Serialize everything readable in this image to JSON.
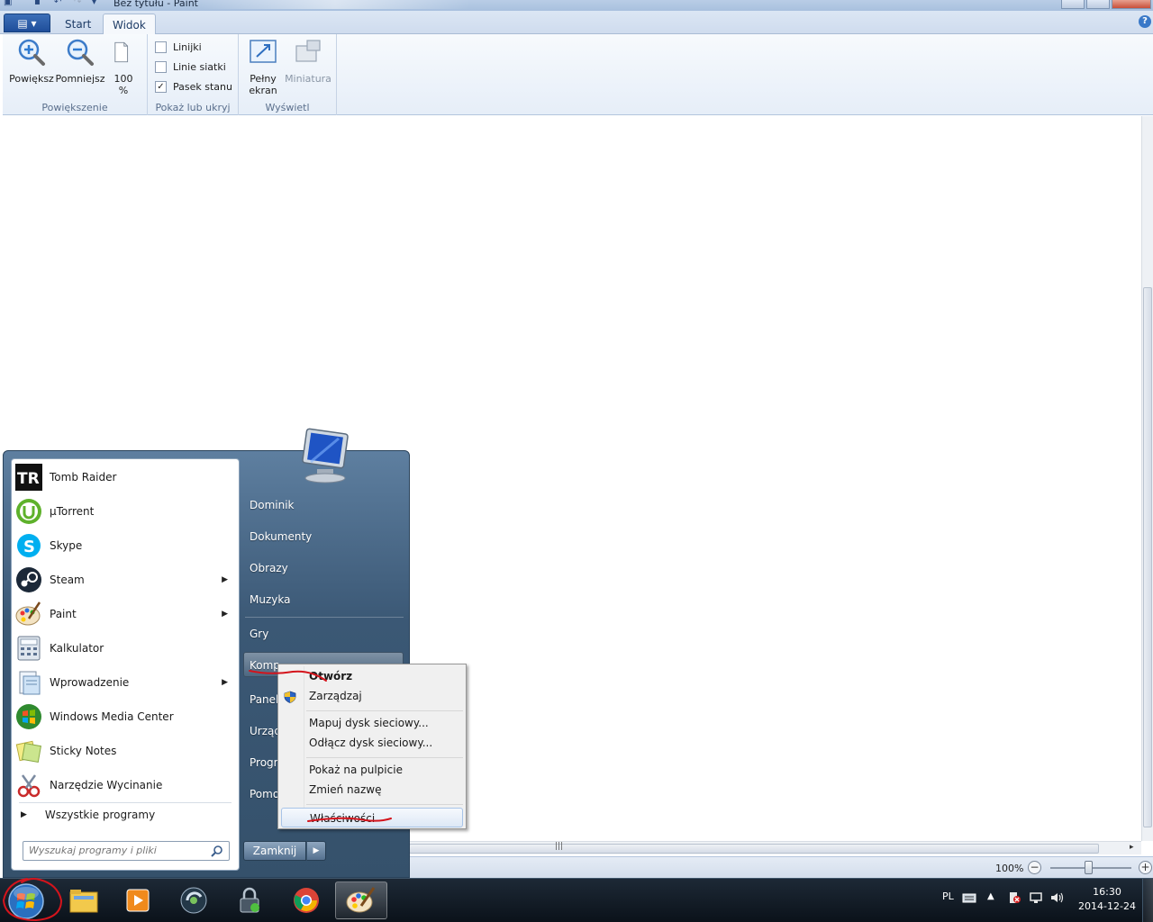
{
  "window": {
    "title": "Bez tytułu - Paint"
  },
  "ribbon": {
    "tabs": [
      "Start",
      "Widok"
    ],
    "active_tab": "Widok",
    "groups": {
      "zoom": {
        "label": "Powiększenie",
        "zoom_in": "Powiększ",
        "zoom_out": "Pomniejsz",
        "hundred_line1": "100",
        "hundred_line2": "%"
      },
      "show_hide": {
        "label": "Pokaż lub ukryj",
        "rulers": "Linijki",
        "rulers_checked": false,
        "gridlines": "Linie siatki",
        "gridlines_checked": false,
        "statusbar": "Pasek stanu",
        "statusbar_checked": true
      },
      "display": {
        "label": "Wyświetl",
        "fullscreen_line1": "Pełny",
        "fullscreen_line2": "ekran",
        "thumbnail": "Miniatura"
      }
    }
  },
  "status": {
    "zoom": "100%"
  },
  "start_menu": {
    "programs": [
      {
        "label": "Tomb Raider",
        "icon": "tomb-raider-icon",
        "submenu": false
      },
      {
        "label": "µTorrent",
        "icon": "utorrent-icon",
        "submenu": false
      },
      {
        "label": "Skype",
        "icon": "skype-icon",
        "submenu": false
      },
      {
        "label": "Steam",
        "icon": "steam-icon",
        "submenu": true
      },
      {
        "label": "Paint",
        "icon": "paint-icon",
        "submenu": true
      },
      {
        "label": "Kalkulator",
        "icon": "calculator-icon",
        "submenu": false
      },
      {
        "label": "Wprowadzenie",
        "icon": "getting-started-icon",
        "submenu": true
      },
      {
        "label": "Windows Media Center",
        "icon": "media-center-icon",
        "submenu": false
      },
      {
        "label": "Sticky Notes",
        "icon": "sticky-notes-icon",
        "submenu": false
      },
      {
        "label": "Narzędzie Wycinanie",
        "icon": "snipping-tool-icon",
        "submenu": false
      }
    ],
    "all_programs": "Wszystkie programy",
    "search_placeholder": "Wyszukaj programy i pliki",
    "right": {
      "user": "Dominik",
      "documents": "Dokumenty",
      "pictures": "Obrazy",
      "music": "Muzyka",
      "games": "Gry",
      "computer": "Komp",
      "control_panel": "Panel",
      "devices": "Urząd",
      "default_programs": "Progr",
      "help": "Pomo"
    },
    "shutdown": "Zamknij"
  },
  "context_menu": {
    "items": [
      {
        "label": "Otwórz",
        "bold": true
      },
      {
        "label": "Zarządzaj",
        "bold": false,
        "icon": "shield-icon"
      },
      {
        "label": "Mapuj dysk sieciowy...",
        "bold": false
      },
      {
        "label": "Odłącz dysk sieciowy...",
        "bold": false
      },
      {
        "label": "Pokaż na pulpicie",
        "bold": false
      },
      {
        "label": "Zmień nazwę",
        "bold": false
      },
      {
        "label": "Właściwości",
        "bold": false,
        "highlighted": true
      }
    ]
  },
  "taskbar": {
    "apps": [
      "explorer-icon",
      "media-player-icon",
      "media-center-icon",
      "lock-app-icon",
      "chrome-icon",
      "paint-icon"
    ],
    "active_app": "paint-icon",
    "language": "PL",
    "time": "16:30",
    "date": "2014-12-24"
  },
  "colors": {
    "annotation": "#d4141c",
    "ribbon_blue": "#1e3c66",
    "start_menu": "#3b5875"
  }
}
